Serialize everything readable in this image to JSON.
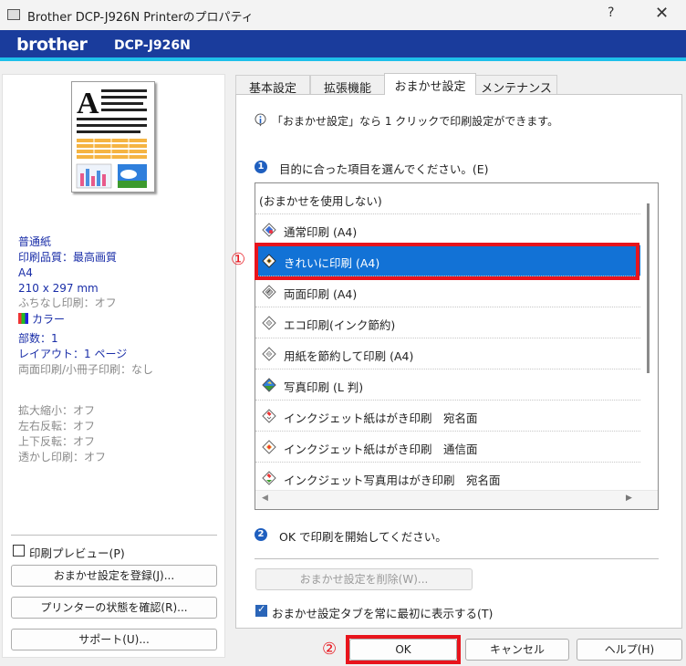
{
  "window": {
    "title": "Brother DCP-J926N Printerのプロパティ",
    "help_glyph": "?",
    "close_glyph": "✕"
  },
  "brand": {
    "logo": "brother",
    "model": "DCP-J926N",
    "bar_color": "#1a3c9c",
    "accent_color": "#1ec0ea"
  },
  "summary": {
    "paper": "普通紙",
    "quality": "印刷品質：最高画質",
    "size": "A4",
    "dimensions": "210 x 297 mm",
    "borderless": "ふちなし印刷：オフ",
    "color": "カラー",
    "copies": "部数：1",
    "layout": "レイアウト：1 ページ",
    "duplex": "両面印刷/小冊子印刷：なし",
    "scaling": "拡大縮小：オフ",
    "mirror": "左右反転：オフ",
    "reverse": "上下反転：オフ",
    "watermark": "透かし印刷：オフ"
  },
  "left_actions": {
    "print_preview": {
      "label": "印刷プレビュー(P)",
      "checked": false
    },
    "register_button": "おまかせ設定を登録(J)...",
    "status_button": "プリンターの状態を確認(R)...",
    "support_button": "サポート(U)..."
  },
  "tabs": [
    "基本設定",
    "拡張機能",
    "おまかせ設定",
    "メンテナンス"
  ],
  "active_tab": "おまかせ設定",
  "panel": {
    "info_text": "「おまかせ設定」なら 1 クリックで印刷設定ができます。",
    "step1_number": "1",
    "step1_text": "目的に合った項目を選んでください。(E)",
    "list_items": [
      {
        "label": "(おまかせを使用しない)",
        "icon": "none"
      },
      {
        "label": "通常印刷 (A4)",
        "icon": "normal-print-icon"
      },
      {
        "label": "きれいに印刷 (A4)",
        "icon": "fine-print-icon",
        "selected": true
      },
      {
        "label": "両面印刷 (A4)",
        "icon": "duplex-print-icon"
      },
      {
        "label": "エコ印刷(インク節約)",
        "icon": "eco-print-icon"
      },
      {
        "label": "用紙を節約して印刷 (A4)",
        "icon": "paper-save-icon"
      },
      {
        "label": "写真印刷 (L 判)",
        "icon": "photo-print-icon"
      },
      {
        "label": "インクジェット紙はがき印刷　宛名面",
        "icon": "postcard-address-icon"
      },
      {
        "label": "インクジェット紙はがき印刷　通信面",
        "icon": "postcard-message-icon"
      },
      {
        "label": "インクジェット写真用はがき印刷　宛名面",
        "icon": "photo-postcard-icon"
      }
    ],
    "step2_number": "2",
    "step2_text": "OK で印刷を開始してください。",
    "delete_button": "おまかせ設定を削除(W)...",
    "always_first": {
      "label": "おまかせ設定タブを常に最初に表示する(T)",
      "checked": true
    }
  },
  "footer": {
    "ok": "OK",
    "cancel": "キャンセル",
    "help": "ヘルプ(H)"
  },
  "annotations": {
    "marker1": "①",
    "marker2": "②",
    "color": "#e8141c"
  },
  "selection_color": "#1272d6"
}
